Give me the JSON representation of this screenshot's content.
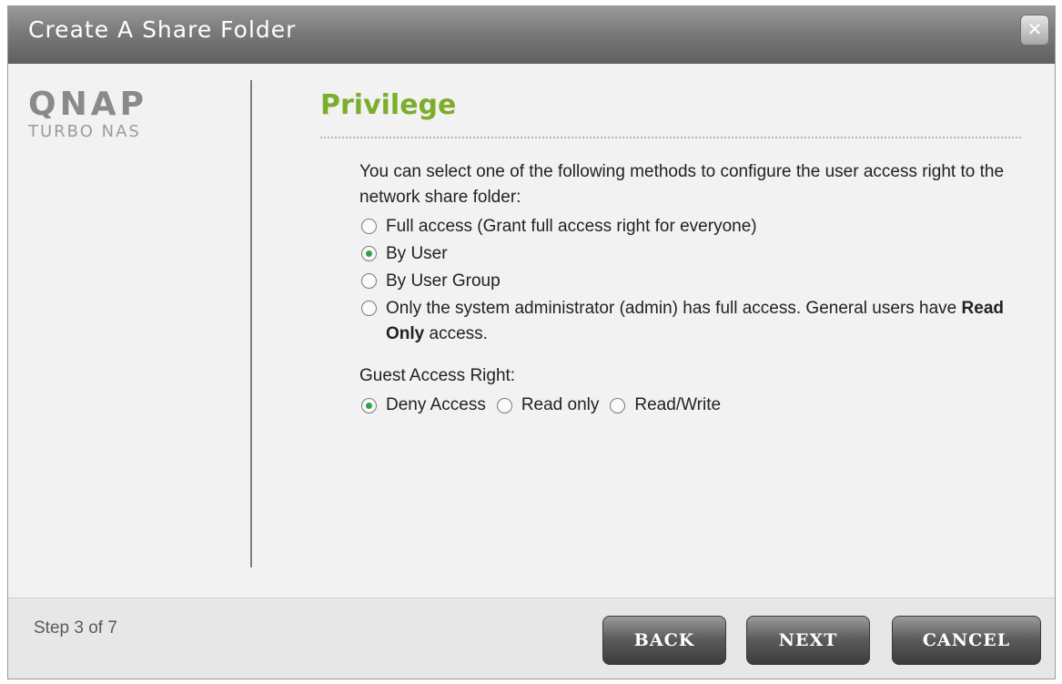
{
  "window": {
    "title": "Create A Share Folder",
    "close_label": "✕"
  },
  "brand": {
    "logo_text": "QNAP",
    "sub": "TURBO NAS",
    "logo_color": "#8a8a8a"
  },
  "page": {
    "title": "Privilege",
    "description": "You can select one of the following methods to configure the user access right to the network share folder:"
  },
  "options": [
    {
      "label": "Full access (Grant full access right for everyone)",
      "checked": false
    },
    {
      "label": "By User",
      "checked": true
    },
    {
      "label": "By User Group",
      "checked": false
    },
    {
      "label_pre": "Only the system administrator (admin) has full access. General users have ",
      "label_bold": "Read Only",
      "label_post": " access.",
      "checked": false
    }
  ],
  "guest": {
    "title": "Guest Access Right:",
    "options": [
      {
        "label": "Deny Access",
        "checked": true
      },
      {
        "label": "Read only",
        "checked": false
      },
      {
        "label": "Read/Write",
        "checked": false
      }
    ]
  },
  "footer": {
    "step": "Step 3 of 7",
    "back": "BACK",
    "next": "NEXT",
    "cancel": "CANCEL"
  },
  "colors": {
    "accent_title": "#7dad2b",
    "radio_checked": "#2fa34a"
  }
}
